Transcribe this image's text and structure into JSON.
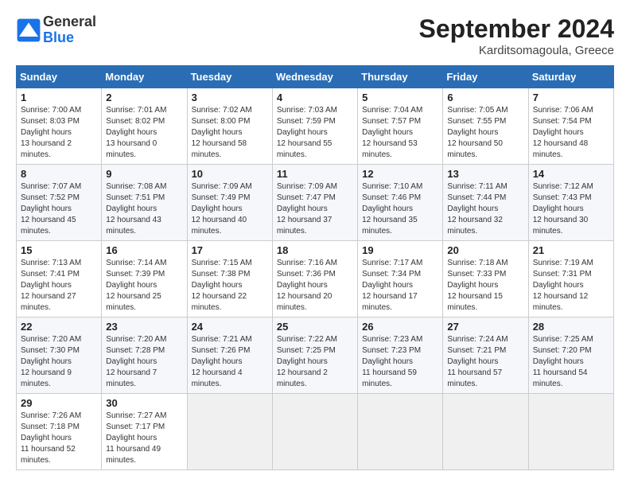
{
  "header": {
    "logo": {
      "general": "General",
      "blue": "Blue"
    },
    "title": "September 2024",
    "location": "Karditsomagoula, Greece"
  },
  "calendar": {
    "days_of_week": [
      "Sunday",
      "Monday",
      "Tuesday",
      "Wednesday",
      "Thursday",
      "Friday",
      "Saturday"
    ],
    "weeks": [
      [
        null,
        {
          "day": 2,
          "sunrise": "7:01 AM",
          "sunset": "8:02 PM",
          "daylight": "13 hours and 0 minutes."
        },
        {
          "day": 3,
          "sunrise": "7:02 AM",
          "sunset": "8:00 PM",
          "daylight": "12 hours and 58 minutes."
        },
        {
          "day": 4,
          "sunrise": "7:03 AM",
          "sunset": "7:59 PM",
          "daylight": "12 hours and 55 minutes."
        },
        {
          "day": 5,
          "sunrise": "7:04 AM",
          "sunset": "7:57 PM",
          "daylight": "12 hours and 53 minutes."
        },
        {
          "day": 6,
          "sunrise": "7:05 AM",
          "sunset": "7:55 PM",
          "daylight": "12 hours and 50 minutes."
        },
        {
          "day": 7,
          "sunrise": "7:06 AM",
          "sunset": "7:54 PM",
          "daylight": "12 hours and 48 minutes."
        }
      ],
      [
        {
          "day": 1,
          "sunrise": "7:00 AM",
          "sunset": "8:03 PM",
          "daylight": "13 hours and 2 minutes."
        },
        {
          "day": 9,
          "sunrise": "7:08 AM",
          "sunset": "7:51 PM",
          "daylight": "12 hours and 43 minutes."
        },
        {
          "day": 10,
          "sunrise": "7:09 AM",
          "sunset": "7:49 PM",
          "daylight": "12 hours and 40 minutes."
        },
        {
          "day": 11,
          "sunrise": "7:09 AM",
          "sunset": "7:47 PM",
          "daylight": "12 hours and 37 minutes."
        },
        {
          "day": 12,
          "sunrise": "7:10 AM",
          "sunset": "7:46 PM",
          "daylight": "12 hours and 35 minutes."
        },
        {
          "day": 13,
          "sunrise": "7:11 AM",
          "sunset": "7:44 PM",
          "daylight": "12 hours and 32 minutes."
        },
        {
          "day": 14,
          "sunrise": "7:12 AM",
          "sunset": "7:43 PM",
          "daylight": "12 hours and 30 minutes."
        }
      ],
      [
        {
          "day": 8,
          "sunrise": "7:07 AM",
          "sunset": "7:52 PM",
          "daylight": "12 hours and 45 minutes."
        },
        {
          "day": 16,
          "sunrise": "7:14 AM",
          "sunset": "7:39 PM",
          "daylight": "12 hours and 25 minutes."
        },
        {
          "day": 17,
          "sunrise": "7:15 AM",
          "sunset": "7:38 PM",
          "daylight": "12 hours and 22 minutes."
        },
        {
          "day": 18,
          "sunrise": "7:16 AM",
          "sunset": "7:36 PM",
          "daylight": "12 hours and 20 minutes."
        },
        {
          "day": 19,
          "sunrise": "7:17 AM",
          "sunset": "7:34 PM",
          "daylight": "12 hours and 17 minutes."
        },
        {
          "day": 20,
          "sunrise": "7:18 AM",
          "sunset": "7:33 PM",
          "daylight": "12 hours and 15 minutes."
        },
        {
          "day": 21,
          "sunrise": "7:19 AM",
          "sunset": "7:31 PM",
          "daylight": "12 hours and 12 minutes."
        }
      ],
      [
        {
          "day": 15,
          "sunrise": "7:13 AM",
          "sunset": "7:41 PM",
          "daylight": "12 hours and 27 minutes."
        },
        {
          "day": 23,
          "sunrise": "7:20 AM",
          "sunset": "7:28 PM",
          "daylight": "12 hours and 7 minutes."
        },
        {
          "day": 24,
          "sunrise": "7:21 AM",
          "sunset": "7:26 PM",
          "daylight": "12 hours and 4 minutes."
        },
        {
          "day": 25,
          "sunrise": "7:22 AM",
          "sunset": "7:25 PM",
          "daylight": "12 hours and 2 minutes."
        },
        {
          "day": 26,
          "sunrise": "7:23 AM",
          "sunset": "7:23 PM",
          "daylight": "11 hours and 59 minutes."
        },
        {
          "day": 27,
          "sunrise": "7:24 AM",
          "sunset": "7:21 PM",
          "daylight": "11 hours and 57 minutes."
        },
        {
          "day": 28,
          "sunrise": "7:25 AM",
          "sunset": "7:20 PM",
          "daylight": "11 hours and 54 minutes."
        }
      ],
      [
        {
          "day": 22,
          "sunrise": "7:20 AM",
          "sunset": "7:30 PM",
          "daylight": "12 hours and 9 minutes."
        },
        {
          "day": 30,
          "sunrise": "7:27 AM",
          "sunset": "7:17 PM",
          "daylight": "11 hours and 49 minutes."
        },
        null,
        null,
        null,
        null,
        null
      ],
      [
        {
          "day": 29,
          "sunrise": "7:26 AM",
          "sunset": "7:18 PM",
          "daylight": "11 hours and 52 minutes."
        },
        null,
        null,
        null,
        null,
        null,
        null
      ]
    ]
  }
}
